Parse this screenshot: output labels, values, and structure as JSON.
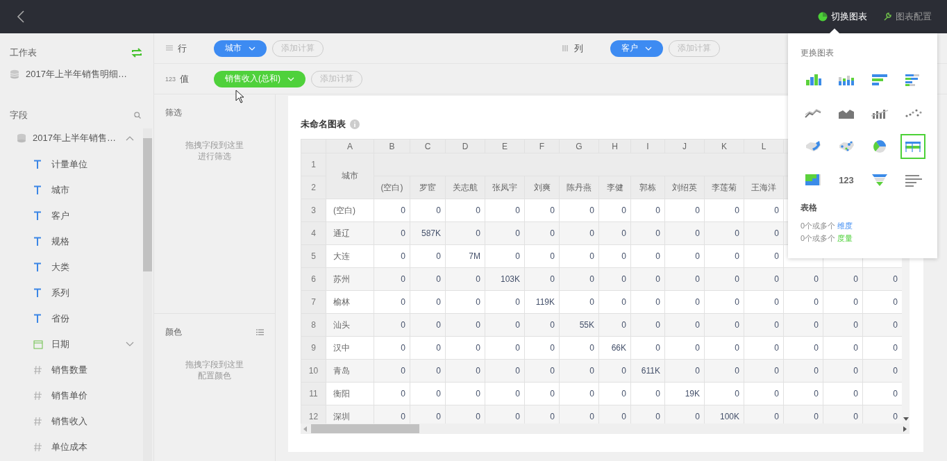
{
  "topbar": {
    "actions": [
      {
        "label": "切换图表",
        "kind": "switch",
        "selected": true
      },
      {
        "label": "图表配置",
        "kind": "config",
        "selected": false
      }
    ]
  },
  "sidebar": {
    "worksheet_title": "工作表",
    "worksheet": "2017年上半年销售明细…",
    "fields_title": "字段",
    "datasets": [
      {
        "name": "2017年上半年销售…",
        "expanded": true,
        "children": [
          {
            "name": "计量单位",
            "kind": "text"
          },
          {
            "name": "城市",
            "kind": "text"
          },
          {
            "name": "客户",
            "kind": "text"
          },
          {
            "name": "规格",
            "kind": "text"
          },
          {
            "name": "大类",
            "kind": "text"
          },
          {
            "name": "系列",
            "kind": "text"
          },
          {
            "name": "省份",
            "kind": "text"
          },
          {
            "name": "日期",
            "kind": "date",
            "expanded": false
          },
          {
            "name": "销售数量",
            "kind": "number"
          },
          {
            "name": "销售单价",
            "kind": "number"
          },
          {
            "name": "销售收入",
            "kind": "number"
          },
          {
            "name": "单位成本",
            "kind": "number"
          }
        ]
      }
    ]
  },
  "shelf_lines": [
    {
      "shelves": [
        {
          "kind": "rows",
          "label": "行",
          "pills": [
            {
              "label": "城市",
              "kind": "dimension"
            }
          ],
          "add": "添加计算"
        },
        {
          "kind": "columns",
          "label": "列",
          "pills": [
            {
              "label": "客户",
              "kind": "dimension"
            }
          ],
          "add": "添加计算"
        }
      ]
    },
    {
      "shelves": [
        {
          "kind": "values",
          "badge": "123",
          "label": "值",
          "pills": [
            {
              "label": "销售收入(总和)",
              "kind": "measure"
            }
          ],
          "add": "添加计算"
        }
      ]
    }
  ],
  "panels": [
    {
      "kind": "filter",
      "title": "筛选",
      "hint": "拖拽字段到这里进行筛选"
    },
    {
      "kind": "color",
      "title": "颜色",
      "hint": "拖拽字段到这里配置颜色"
    }
  ],
  "chart": {
    "title": "未命名图表",
    "table": {
      "column_letters": [
        "A",
        "B",
        "C",
        "D",
        "E",
        "F",
        "G",
        "H",
        "I",
        "J",
        "K",
        "L"
      ],
      "header_row_numbers": [
        "1",
        "2"
      ],
      "row_header": "城市",
      "columns": [
        "(空白)",
        "罗宦",
        "关志航",
        "张凤宇",
        "刘爽",
        "陈丹燕",
        "李健",
        "郭栋",
        "刘绍英",
        "李莲菊",
        "王海洋"
      ],
      "rows": [
        {
          "num": "3",
          "city": "(空白)",
          "values": [
            "0",
            "0",
            "0",
            "0",
            "0",
            "0",
            "0",
            "0",
            "0",
            "0",
            "0"
          ]
        },
        {
          "num": "4",
          "city": "通辽",
          "values": [
            "0",
            "587K",
            "0",
            "0",
            "0",
            "0",
            "0",
            "0",
            "0",
            "0",
            "0"
          ]
        },
        {
          "num": "5",
          "city": "大连",
          "values": [
            "0",
            "0",
            "7M",
            "0",
            "0",
            "0",
            "0",
            "0",
            "0",
            "0",
            "0"
          ]
        },
        {
          "num": "6",
          "city": "苏州",
          "values": [
            "0",
            "0",
            "0",
            "103K",
            "0",
            "0",
            "0",
            "0",
            "0",
            "0",
            "0",
            "0",
            "0",
            "0"
          ]
        },
        {
          "num": "7",
          "city": "榆林",
          "values": [
            "0",
            "0",
            "0",
            "0",
            "119K",
            "0",
            "0",
            "0",
            "0",
            "0",
            "0",
            "0",
            "0",
            "0"
          ]
        },
        {
          "num": "8",
          "city": "汕头",
          "values": [
            "0",
            "0",
            "0",
            "0",
            "0",
            "55K",
            "0",
            "0",
            "0",
            "0",
            "0",
            "0",
            "0",
            "0"
          ]
        },
        {
          "num": "9",
          "city": "汉中",
          "values": [
            "0",
            "0",
            "0",
            "0",
            "0",
            "0",
            "66K",
            "0",
            "0",
            "0",
            "0",
            "0",
            "0",
            "0"
          ]
        },
        {
          "num": "10",
          "city": "青岛",
          "values": [
            "0",
            "0",
            "0",
            "0",
            "0",
            "0",
            "0",
            "611K",
            "0",
            "0",
            "0",
            "0",
            "0",
            "0"
          ]
        },
        {
          "num": "11",
          "city": "衡阳",
          "values": [
            "0",
            "0",
            "0",
            "0",
            "0",
            "0",
            "0",
            "0",
            "19K",
            "0",
            "0",
            "0",
            "0",
            "0"
          ]
        },
        {
          "num": "12",
          "city": "深圳",
          "values": [
            "0",
            "0",
            "0",
            "0",
            "0",
            "0",
            "0",
            "0",
            "0",
            "100K",
            "0",
            "0",
            "0",
            "0"
          ]
        }
      ]
    }
  },
  "popup": {
    "title": "更换图表",
    "types": [
      {
        "kind": "bar",
        "selected": false
      },
      {
        "kind": "stacked-bar",
        "selected": false
      },
      {
        "kind": "hbar",
        "selected": false
      },
      {
        "kind": "stacked-hbar",
        "selected": false
      },
      {
        "kind": "line",
        "selected": false
      },
      {
        "kind": "area",
        "selected": false
      },
      {
        "kind": "combo",
        "selected": false
      },
      {
        "kind": "scatter",
        "selected": false
      },
      {
        "kind": "map",
        "selected": false
      },
      {
        "kind": "point-map",
        "selected": false
      },
      {
        "kind": "pie",
        "selected": false
      },
      {
        "kind": "table",
        "selected": true
      },
      {
        "kind": "treemap",
        "selected": false
      },
      {
        "kind": "number",
        "label": "123",
        "selected": false
      },
      {
        "kind": "funnel",
        "selected": false
      },
      {
        "kind": "ranking",
        "selected": false
      }
    ],
    "selected_name": "表格",
    "requirements": [
      {
        "prefix": "0个或多个",
        "term": "维度",
        "kind": "dimension"
      },
      {
        "prefix": "0个或多个",
        "term": "度量",
        "kind": "measure"
      }
    ]
  }
}
